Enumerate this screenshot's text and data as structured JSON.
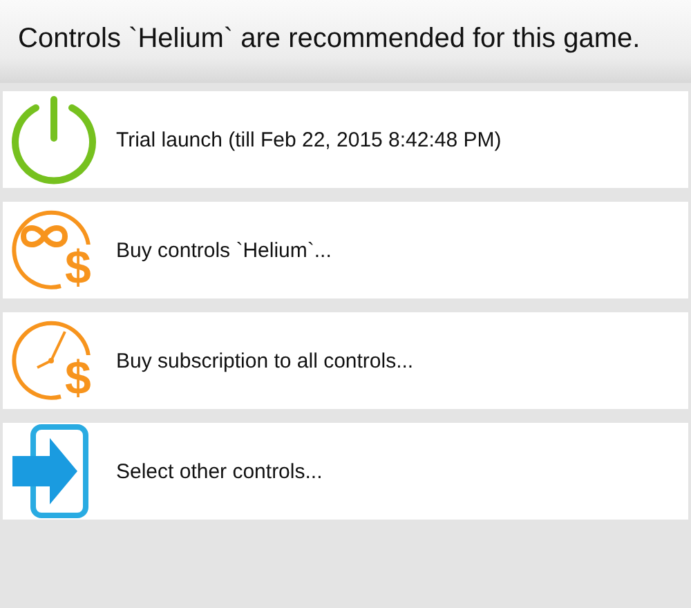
{
  "header": {
    "title": "Controls `Helium` are recommended for this game."
  },
  "options": [
    {
      "kind": "power",
      "label": "Trial launch (till Feb 22, 2015 8:42:48 PM)"
    },
    {
      "kind": "infinity",
      "label": "Buy controls `Helium`...",
      "badge": "$"
    },
    {
      "kind": "clock",
      "label": "Buy subscription to all controls...",
      "badge": "$"
    },
    {
      "kind": "enter",
      "label": "Select other controls..."
    }
  ]
}
